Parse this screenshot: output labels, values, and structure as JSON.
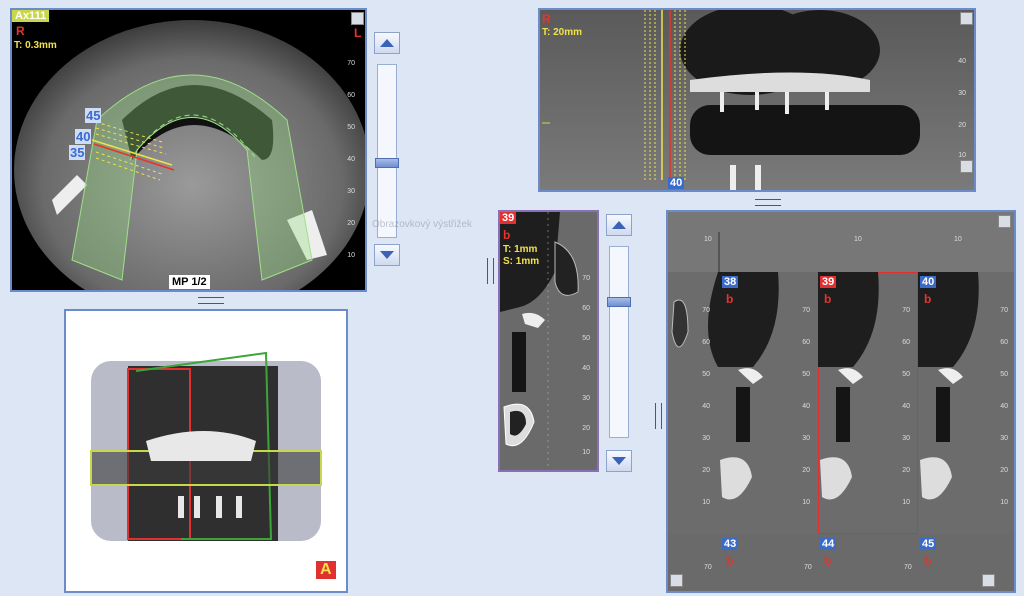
{
  "axial": {
    "view_label": "Ax111",
    "orient_left": "R",
    "orient_right": "L",
    "thickness": "T: 0.3mm",
    "curve_label": "MP 1/2",
    "section_nums": [
      "45",
      "40",
      "35"
    ],
    "ruler": [
      "70",
      "60",
      "50",
      "40",
      "30",
      "20",
      "10"
    ]
  },
  "panoramic": {
    "orient": "R",
    "thickness": "T: 20mm",
    "section_num": "40",
    "ruler": [
      "40",
      "30",
      "20",
      "10"
    ]
  },
  "cross_single": {
    "index": "39",
    "side": "b",
    "thickness": "T: 1mm",
    "spacing": "S: 1mm",
    "ruler": [
      "70",
      "60",
      "50",
      "40",
      "30",
      "20",
      "10"
    ]
  },
  "cross_grid": {
    "top_ruler": [
      "10",
      "10",
      "10"
    ],
    "cells": [
      {
        "num": "38",
        "side": "b",
        "selected": false
      },
      {
        "num": "39",
        "side": "b",
        "selected": true
      },
      {
        "num": "40",
        "side": "b",
        "selected": false
      }
    ],
    "cell_ruler": [
      "70",
      "60",
      "50",
      "40",
      "30",
      "20",
      "10"
    ],
    "bottom": [
      {
        "num": "43",
        "side": "b",
        "tick": "70"
      },
      {
        "num": "44",
        "side": "b",
        "tick": "70"
      },
      {
        "num": "45",
        "side": "b",
        "tick": "70"
      }
    ]
  },
  "render3d": {
    "orient_badge": "A"
  },
  "watermark": "Obrazovkový výstřižek",
  "colors": {
    "panel_border": "#6b8cc8",
    "background": "#dde6f5",
    "accent_blue": "#3b6bd0",
    "marker_red": "#e8322b",
    "marker_yellow": "#f2e24a",
    "curve_green": "#9ee08a"
  }
}
